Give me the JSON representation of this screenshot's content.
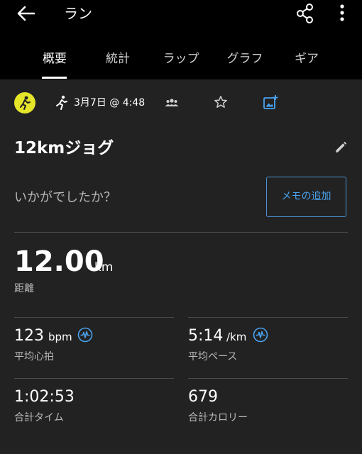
{
  "header": {
    "title": "ラン",
    "icons": [
      "back-arrow-icon",
      "share-icon",
      "more-vertical-icon"
    ]
  },
  "tabs": [
    {
      "label": "概要",
      "active": true
    },
    {
      "label": "統計",
      "active": false
    },
    {
      "label": "ラップ",
      "active": false
    },
    {
      "label": "グラフ",
      "active": false
    },
    {
      "label": "ギア",
      "active": false
    }
  ],
  "activity": {
    "date": "3月7日 @ 4:48",
    "name": "12kmジョグ",
    "prompt": "いかがでしたか？",
    "memo_button": "メモの追加",
    "icons": [
      "avatar",
      "running-icon",
      "people-icon",
      "star-icon",
      "add-photo-icon",
      "edit-pencil-icon"
    ]
  },
  "distance": {
    "value": "12.00",
    "unit": "km",
    "label": "距離"
  },
  "stats": {
    "heart_rate": {
      "value": "123",
      "unit": "bpm",
      "label": "平均心拍"
    },
    "pace": {
      "value": "5:14",
      "unit": "/km",
      "label": "平均ペース"
    },
    "time": {
      "value": "1:02:53",
      "label": "合計タイム"
    },
    "calories": {
      "value": "679",
      "label": "合計カロリー"
    }
  },
  "colors": {
    "background": "#222222",
    "header_background": "#000000",
    "accent_blue": "#4aa3f0",
    "avatar_yellow": "#e5e52a"
  }
}
